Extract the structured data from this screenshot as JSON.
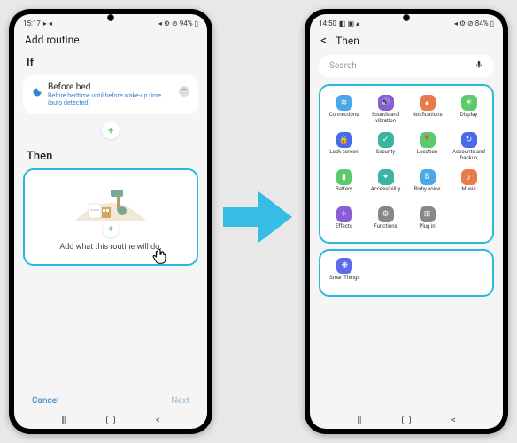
{
  "left": {
    "status": {
      "time": "15:17",
      "battery": "94%"
    },
    "header": "Add routine",
    "if_label": "If",
    "before_bed": {
      "title": "Before bed",
      "subtitle": "Before bedtime until before wake-up time (auto detected)"
    },
    "then_label": "Then",
    "then_hint": "Add what this routine will do.",
    "cancel": "Cancel",
    "next": "Next"
  },
  "right": {
    "status": {
      "time": "14:50",
      "battery": "84%"
    },
    "header": "Then",
    "search_placeholder": "Search",
    "items": [
      {
        "label": "Connections",
        "color": "#4aa8e8",
        "glyph": "≋"
      },
      {
        "label": "Sounds and vibration",
        "color": "#8a5cd6",
        "glyph": "🔊"
      },
      {
        "label": "Notifications",
        "color": "#e87b4a",
        "glyph": "●"
      },
      {
        "label": "Display",
        "color": "#5cc96a",
        "glyph": "☀"
      },
      {
        "label": "Lock screen",
        "color": "#4a6be8",
        "glyph": "🔒"
      },
      {
        "label": "Security",
        "color": "#3ab5a0",
        "glyph": "✓"
      },
      {
        "label": "Location",
        "color": "#5cc96a",
        "glyph": "📍"
      },
      {
        "label": "Accounts and backup",
        "color": "#4a6be8",
        "glyph": "↻"
      },
      {
        "label": "Battery",
        "color": "#5cc96a",
        "glyph": "▮"
      },
      {
        "label": "Accessibility",
        "color": "#3ab5a0",
        "glyph": "✦"
      },
      {
        "label": "Bixby voice",
        "color": "#4aa8e8",
        "glyph": "B"
      },
      {
        "label": "Music",
        "color": "#e87b4a",
        "glyph": "♪"
      },
      {
        "label": "Effects",
        "color": "#8a5cd6",
        "glyph": "✧"
      },
      {
        "label": "Functions",
        "color": "#888888",
        "glyph": "⚙"
      },
      {
        "label": "Plug in",
        "color": "#888888",
        "glyph": "⊞"
      }
    ],
    "smart": {
      "label": "SmartThings",
      "color": "#5c6be8",
      "glyph": "❋"
    }
  }
}
